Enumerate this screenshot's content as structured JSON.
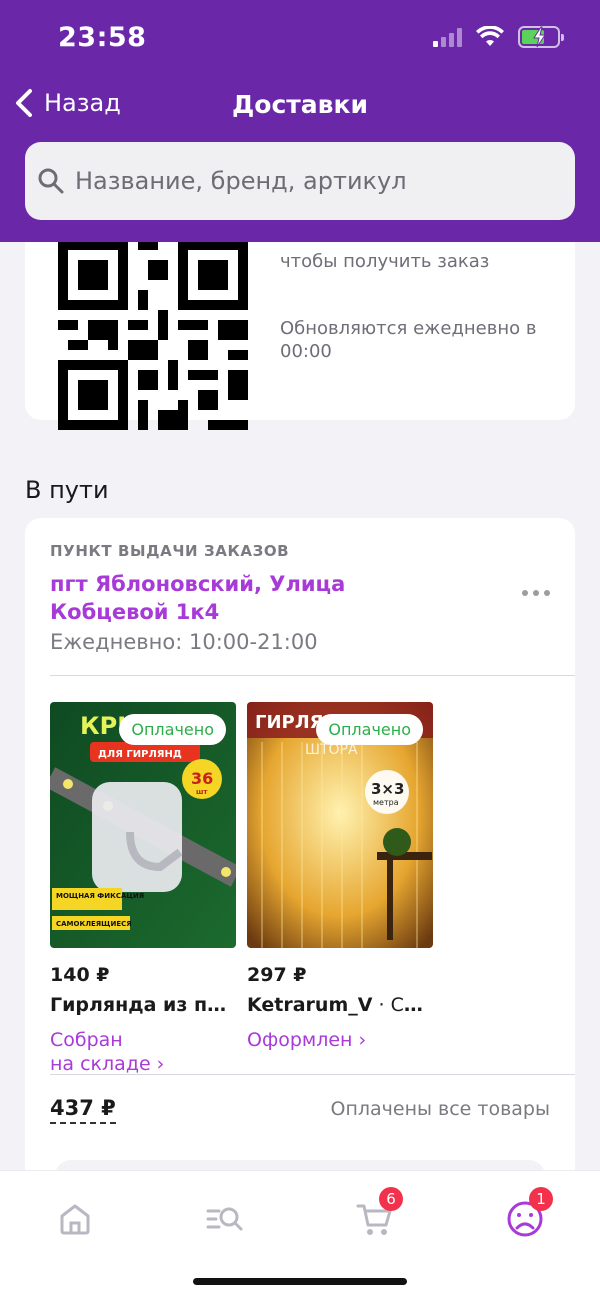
{
  "status_bar": {
    "time": "23:58"
  },
  "nav": {
    "back_label": "Назад",
    "title": "Доставки"
  },
  "search": {
    "placeholder": "Название, бренд, артикул"
  },
  "qr_card": {
    "text_top": "чтобы получить заказ",
    "text_update": "Обновляются ежедневно в 00:00"
  },
  "in_transit": {
    "title": "В пути",
    "pickup_label": "ПУНКТ ВЫДАЧИ ЗАКАЗОВ",
    "pickup_address": "пгт Яблоновский, Улица Кобцевой 1к4",
    "hours": "Ежедневно: 10:00-21:00",
    "products": [
      {
        "badge": "Оплачено",
        "price": "140 ₽",
        "name": "Гирлянда из пр...",
        "status_line1": "Собран",
        "status_line2": "на складе ›",
        "image_texts": [
          "КРЮЧКИ",
          "ДЛЯ ГИРЛЯНД",
          "36",
          "шт",
          "МОЩНАЯ ФИКСАЦИЯ",
          "САМОКЛЕЯЩИЕСЯ"
        ]
      },
      {
        "badge": "Оплачено",
        "price": "297 ₽",
        "name": "Ketrarum_V",
        "name_suffix": " · Св...",
        "status_line1": "Оформлен ›",
        "image_texts": [
          "ГИРЛЯНДА",
          "ШТОРА",
          "3×3",
          "метра"
        ]
      }
    ],
    "total": "437 ₽",
    "total_status": "Оплачены все товары"
  },
  "tabbar": {
    "cart_badge": "6",
    "profile_badge": "1"
  },
  "colors": {
    "header": "#6a28a8",
    "accent": "#a83ad8",
    "paid": "#2cae4a",
    "badge": "#f2314c"
  }
}
